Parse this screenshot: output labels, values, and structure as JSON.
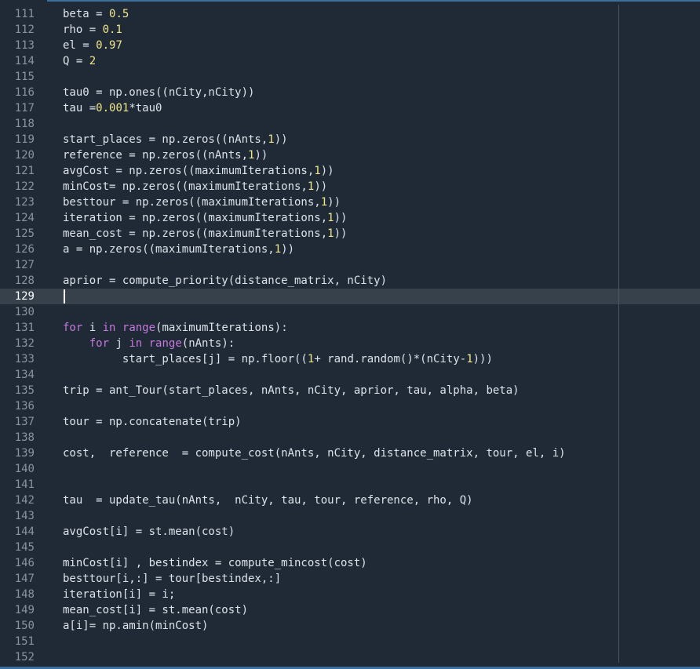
{
  "editor": {
    "current_line": 129,
    "lines": [
      {
        "n": "111",
        "t": "beta = [[0.5]]"
      },
      {
        "n": "112",
        "t": "rho = [[0.1]]"
      },
      {
        "n": "113",
        "t": "el = [[0.97]]"
      },
      {
        "n": "114",
        "t": "Q = [[2]]"
      },
      {
        "n": "115",
        "t": ""
      },
      {
        "n": "116",
        "t": "tau0 = np.ones((nCity,nCity))"
      },
      {
        "n": "117",
        "t": "tau =[[0.001]]*tau0"
      },
      {
        "n": "118",
        "t": ""
      },
      {
        "n": "119",
        "t": "start_places = np.zeros((nAnts,[[1]]))"
      },
      {
        "n": "120",
        "t": "reference = np.zeros((nAnts,[[1]]))"
      },
      {
        "n": "121",
        "t": "avgCost = np.zeros((maximumIterations,[[1]]))"
      },
      {
        "n": "122",
        "t": "minCost= np.zeros((maximumIterations,[[1]]))"
      },
      {
        "n": "123",
        "t": "besttour = np.zeros((maximumIterations,[[1]]))"
      },
      {
        "n": "124",
        "t": "iteration = np.zeros((maximumIterations,[[1]]))"
      },
      {
        "n": "125",
        "t": "mean_cost = np.zeros((maximumIterations,[[1]]))"
      },
      {
        "n": "126",
        "t": "a = np.zeros((maximumIterations,[[1]]))"
      },
      {
        "n": "127",
        "t": ""
      },
      {
        "n": "128",
        "t": "aprior = compute_priority(distance_matrix, nCity)"
      },
      {
        "n": "129",
        "t": ""
      },
      {
        "n": "130",
        "t": ""
      },
      {
        "n": "131",
        "t": "{{for}} i {{in}} {{range}}(maximumIterations):"
      },
      {
        "n": "132",
        "t": "    {{for}} j {{in}} {{range}}(nAnts):"
      },
      {
        "n": "133",
        "t": "         start_places[j] = np.floor(([[1]]+ rand.random()*(nCity-[[1]])))"
      },
      {
        "n": "134",
        "t": ""
      },
      {
        "n": "135",
        "t": "trip = ant_Tour(start_places, nAnts, nCity, aprior, tau, alpha, beta)"
      },
      {
        "n": "136",
        "t": ""
      },
      {
        "n": "137",
        "t": "tour = np.concatenate(trip)"
      },
      {
        "n": "138",
        "t": ""
      },
      {
        "n": "139",
        "t": "cost,  reference  = compute_cost(nAnts, nCity, distance_matrix, tour, el, i)"
      },
      {
        "n": "140",
        "t": ""
      },
      {
        "n": "141",
        "t": ""
      },
      {
        "n": "142",
        "t": "tau  = update_tau(nAnts,  nCity, tau, tour, reference, rho, Q)"
      },
      {
        "n": "143",
        "t": ""
      },
      {
        "n": "144",
        "t": "avgCost[i] = st.mean(cost)"
      },
      {
        "n": "145",
        "t": ""
      },
      {
        "n": "146",
        "t": "minCost[i] , bestindex = compute_mincost(cost)"
      },
      {
        "n": "147",
        "t": "besttour[i,:] = tour[bestindex,:]"
      },
      {
        "n": "148",
        "t": "iteration[i] = i;"
      },
      {
        "n": "149",
        "t": "mean_cost[i] = st.mean(cost)"
      },
      {
        "n": "150",
        "t": "a[i]= np.amin(minCost)"
      },
      {
        "n": "151",
        "t": ""
      },
      {
        "n": "152",
        "t": ""
      }
    ]
  }
}
